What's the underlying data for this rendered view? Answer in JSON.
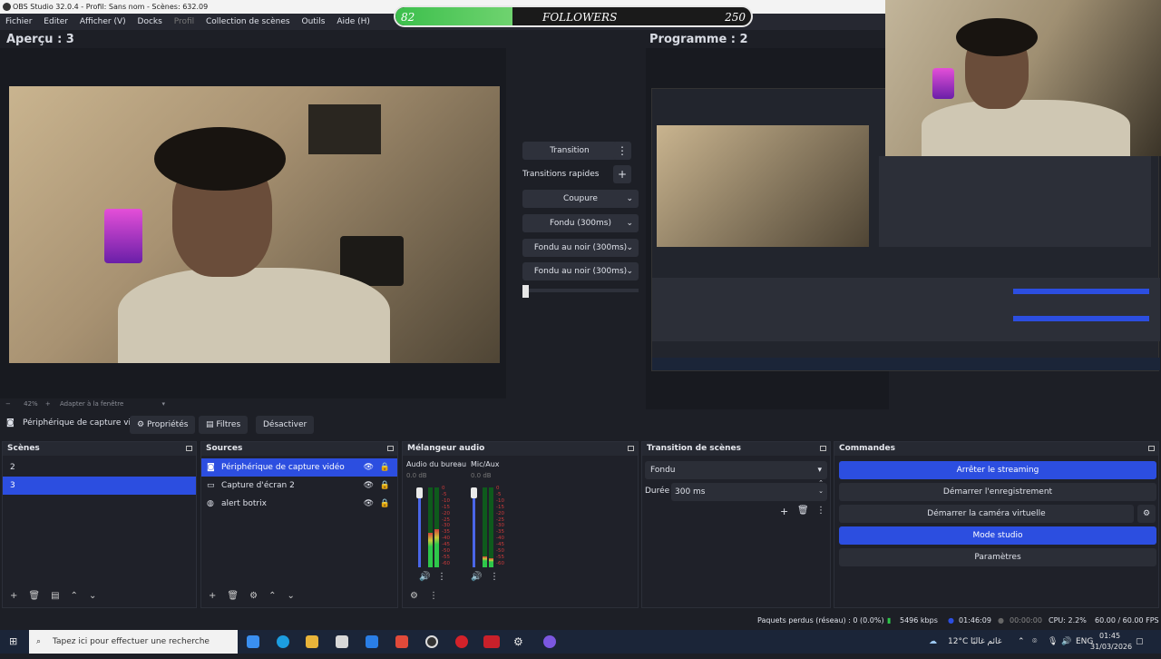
{
  "window": {
    "title": "OBS Studio 32.0.4 - Profil: Sans nom - Scènes: 632.09"
  },
  "menu": [
    "Fichier",
    "Editer",
    "Afficher (V)",
    "Docks",
    "Profil",
    "Collection de scènes",
    "Outils",
    "Aide (H)"
  ],
  "followers": {
    "current": "82",
    "label": "FOLLOWERS",
    "goal": "250",
    "progress_fraction": 0.33
  },
  "preview": {
    "title": "Aperçu : 3",
    "zoom": "42%",
    "zoom_mode": "Adapter à la fenêtre"
  },
  "program": {
    "title": "Programme : 2"
  },
  "transitions": {
    "button": "Transition",
    "quick_label": "Transitions rapides",
    "items": [
      "Coupure",
      "Fondu (300ms)",
      "Fondu au noir (300ms)",
      "Fondu au noir (300ms)"
    ]
  },
  "source_toolbar": {
    "selected": "Périphérique de capture vi",
    "properties": "Propriétés",
    "filters": "Filtres",
    "deactivate": "Désactiver"
  },
  "scenes": {
    "title": "Scènes",
    "items": [
      "2",
      "3"
    ],
    "selected_index": 1
  },
  "sources": {
    "title": "Sources",
    "items": [
      "Périphérique de capture vidéo",
      "Capture d'écran 2",
      "alert botrix"
    ]
  },
  "mixer": {
    "title": "Mélangeur audio",
    "channels": [
      {
        "name": "Audio du bureau",
        "db": "0.0 dB"
      },
      {
        "name": "Mic/Aux",
        "db": "0.0 dB"
      }
    ],
    "scale": [
      "0",
      "-5",
      "-10",
      "-15",
      "-20",
      "-25",
      "-30",
      "-35",
      "-40",
      "-45",
      "-50",
      "-55",
      "-60"
    ]
  },
  "scene_transition": {
    "title": "Transition de scènes",
    "type": "Fondu",
    "duration_label": "Durée",
    "duration": "300 ms"
  },
  "commands": {
    "title": "Commandes",
    "buttons": [
      "Arrêter le streaming",
      "Démarrer l'enregistrement",
      "Démarrer la caméra virtuelle",
      "Mode studio",
      "Paramètres"
    ]
  },
  "status": {
    "dropped": "Paquets perdus (réseau) : 0 (0.0%)",
    "bitrate": "5496 kbps",
    "stream_time": "01:46:09",
    "rec_time": "00:00:00",
    "cpu": "CPU: 2.2%",
    "fps": "60.00 / 60.00 FPS"
  },
  "taskbar": {
    "search_placeholder": "Tapez ici pour effectuer une recherche",
    "weather": "12°C",
    "weather_text": "غائم غالبًا",
    "time": "01:45",
    "date": "31/03/2026"
  }
}
